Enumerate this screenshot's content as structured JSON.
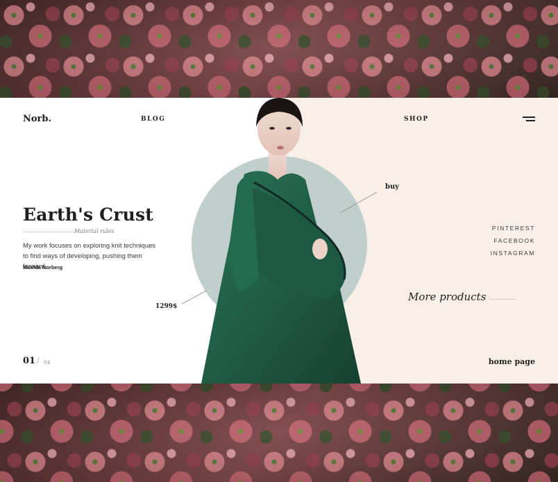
{
  "brand": {
    "logo": "Norb."
  },
  "nav": {
    "blog": "BLOG",
    "shop": "SHOP",
    "menu_icon": "hamburger-menu-icon"
  },
  "hero": {
    "title": "Earth's Crust",
    "subtitle": "Material rules",
    "description": "My work focuses on exploring knit techniques to find ways of developing, pushing them forward.",
    "author": "Matilda Norberg"
  },
  "product": {
    "price": "1299$",
    "buy_label": "buy"
  },
  "social": [
    "PINTEREST",
    "FACEBOOK",
    "INSTAGRAM"
  ],
  "more_products": "More products",
  "pager": {
    "current": "01",
    "separator": "/",
    "total": "04"
  },
  "home_link": "home page",
  "colors": {
    "accent_circle": "#c1cfcc",
    "panel_pink": "#f9efe9",
    "coat_green": "#1f5c45",
    "text_dark": "#1f1f1f"
  }
}
